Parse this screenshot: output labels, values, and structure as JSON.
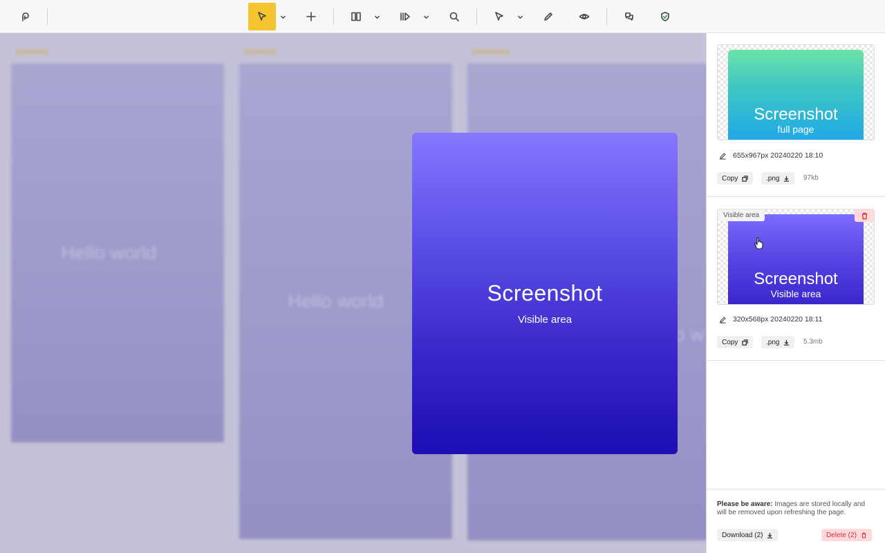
{
  "toolbar": {
    "icons": [
      "logo-icon",
      "pointer-icon",
      "chevron-down-icon",
      "plus-icon",
      "columns-icon",
      "chevron-down-icon",
      "play-icon",
      "chevron-down-icon",
      "search-icon",
      "cursor-icon",
      "chevron-down-icon",
      "pencil-icon",
      "eye-icon",
      "comments-icon",
      "shield-check-icon"
    ],
    "active_tool": "pointer",
    "accent": "#f5c531"
  },
  "canvas": {
    "frame_labels": [
      "Hello world",
      "Hello world",
      "o w"
    ]
  },
  "preview": {
    "title": "Screenshot",
    "subtitle": "Visible area"
  },
  "panel": {
    "screenshots": [
      {
        "thumb_title": "Screenshot",
        "thumb_subtitle": "full page",
        "meta": "655x967px 20240220 18:10",
        "copy_label": "Copy",
        "format_label": ".png",
        "size": "97kb",
        "gradient": [
          "#6ae3a8",
          "#20a8e8"
        ]
      },
      {
        "tag": "Visible area",
        "thumb_title": "Screenshot",
        "thumb_subtitle": "Visible area",
        "meta": "320x568px 20240220 18:11",
        "copy_label": "Copy",
        "format_label": ".png",
        "size": "5.3mb",
        "gradient": [
          "#7a6cff",
          "#3a26cc"
        ]
      }
    ],
    "notice_bold": "Please be aware:",
    "notice_text": " Images are stored locally and will be removed upon refreshing the page.",
    "download_all_label": "Download (2)",
    "delete_all_label": "Delete (2)",
    "danger_color": "#d32f3a"
  }
}
